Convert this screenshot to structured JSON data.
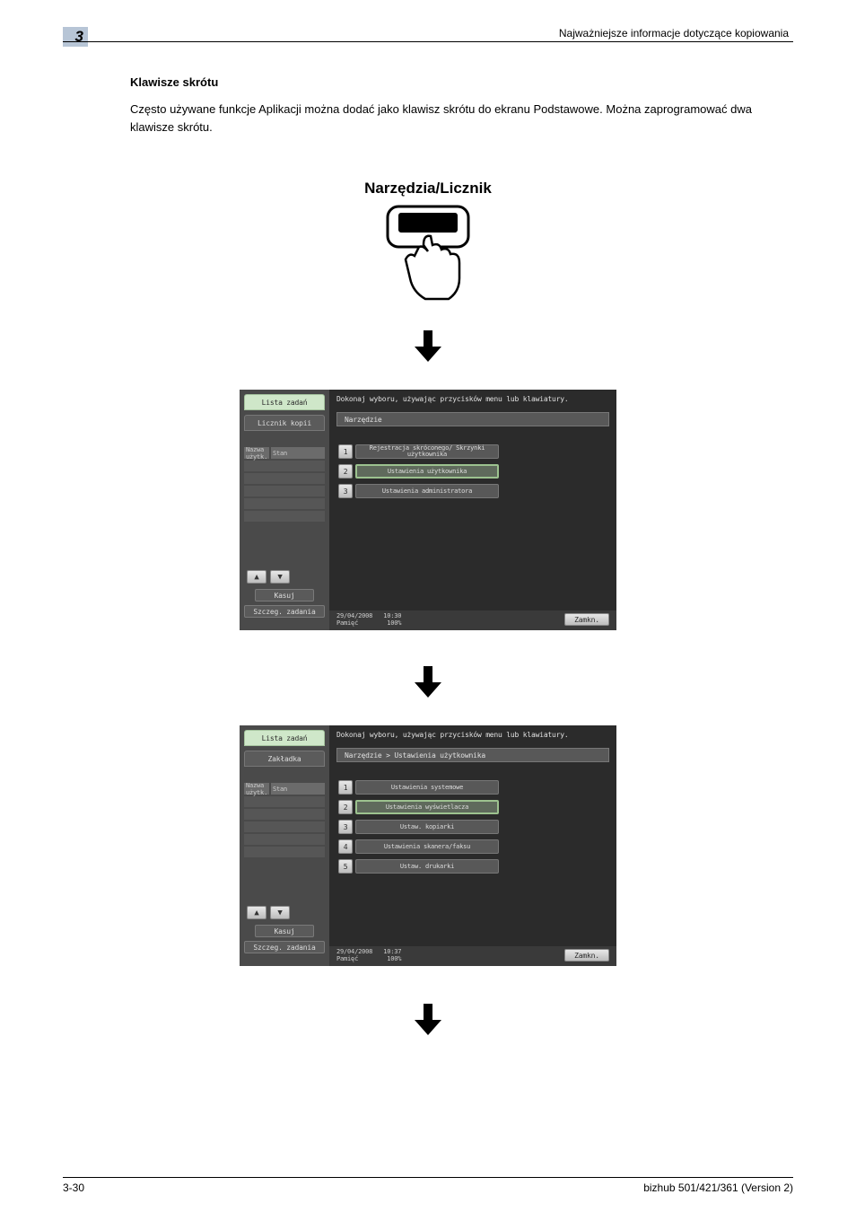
{
  "header": {
    "right": "Najważniejsze informacje dotyczące kopiowania",
    "chapter": "3"
  },
  "section": {
    "title": "Klawisze skrótu"
  },
  "body": "Często używane funkcje Aplikacji można dodać jako klawisz skrótu do ekranu Podstawowe. Można zaprogramować dwa klawisze skrótu.",
  "fig_title": "Narzędzia/Licznik",
  "panel1": {
    "instruction": "Dokonaj wyboru, używając przycisków menu lub klawiatury.",
    "breadcrumb": "Narzędzie",
    "tab_active": "Lista zadań",
    "tab_inactive": "Licznik kopii",
    "header_a": "Nazwa użytk.",
    "header_b": "Stan",
    "kasuj": "Kasuj",
    "szczeg": "Szczeg. zadania",
    "menu": [
      {
        "n": "1",
        "label": "Rejestracja skróconego/ Skrzynki użytkownika"
      },
      {
        "n": "2",
        "label": "Ustawienia użytkownika",
        "selected": true
      },
      {
        "n": "3",
        "label": "Ustawienia administratora"
      }
    ],
    "status_date": "29/04/2008",
    "status_time": "10:30",
    "status_mem": "Pamięć",
    "status_pct": "100%",
    "close": "Zamkn."
  },
  "panel2": {
    "instruction": "Dokonaj wyboru, używając przycisków menu lub klawiatury.",
    "breadcrumb": "Narzędzie > Ustawienia użytkownika",
    "tab_active": "Lista zadań",
    "tab_inactive": "Zakładka",
    "header_a": "Nazwa użytk.",
    "header_b": "Stan",
    "kasuj": "Kasuj",
    "szczeg": "Szczeg. zadania",
    "menu": [
      {
        "n": "1",
        "label": "Ustawienia systemowe"
      },
      {
        "n": "2",
        "label": "Ustawienia wyświetlacza",
        "selected": true
      },
      {
        "n": "3",
        "label": "Ustaw. kopiarki"
      },
      {
        "n": "4",
        "label": "Ustawienia skanera/faksu"
      },
      {
        "n": "5",
        "label": "Ustaw. drukarki"
      }
    ],
    "status_date": "29/04/2008",
    "status_time": "10:37",
    "status_mem": "Pamięć",
    "status_pct": "100%",
    "close": "Zamkn."
  },
  "footer": {
    "left": "3-30",
    "right": "bizhub 501/421/361 (Version 2)"
  }
}
